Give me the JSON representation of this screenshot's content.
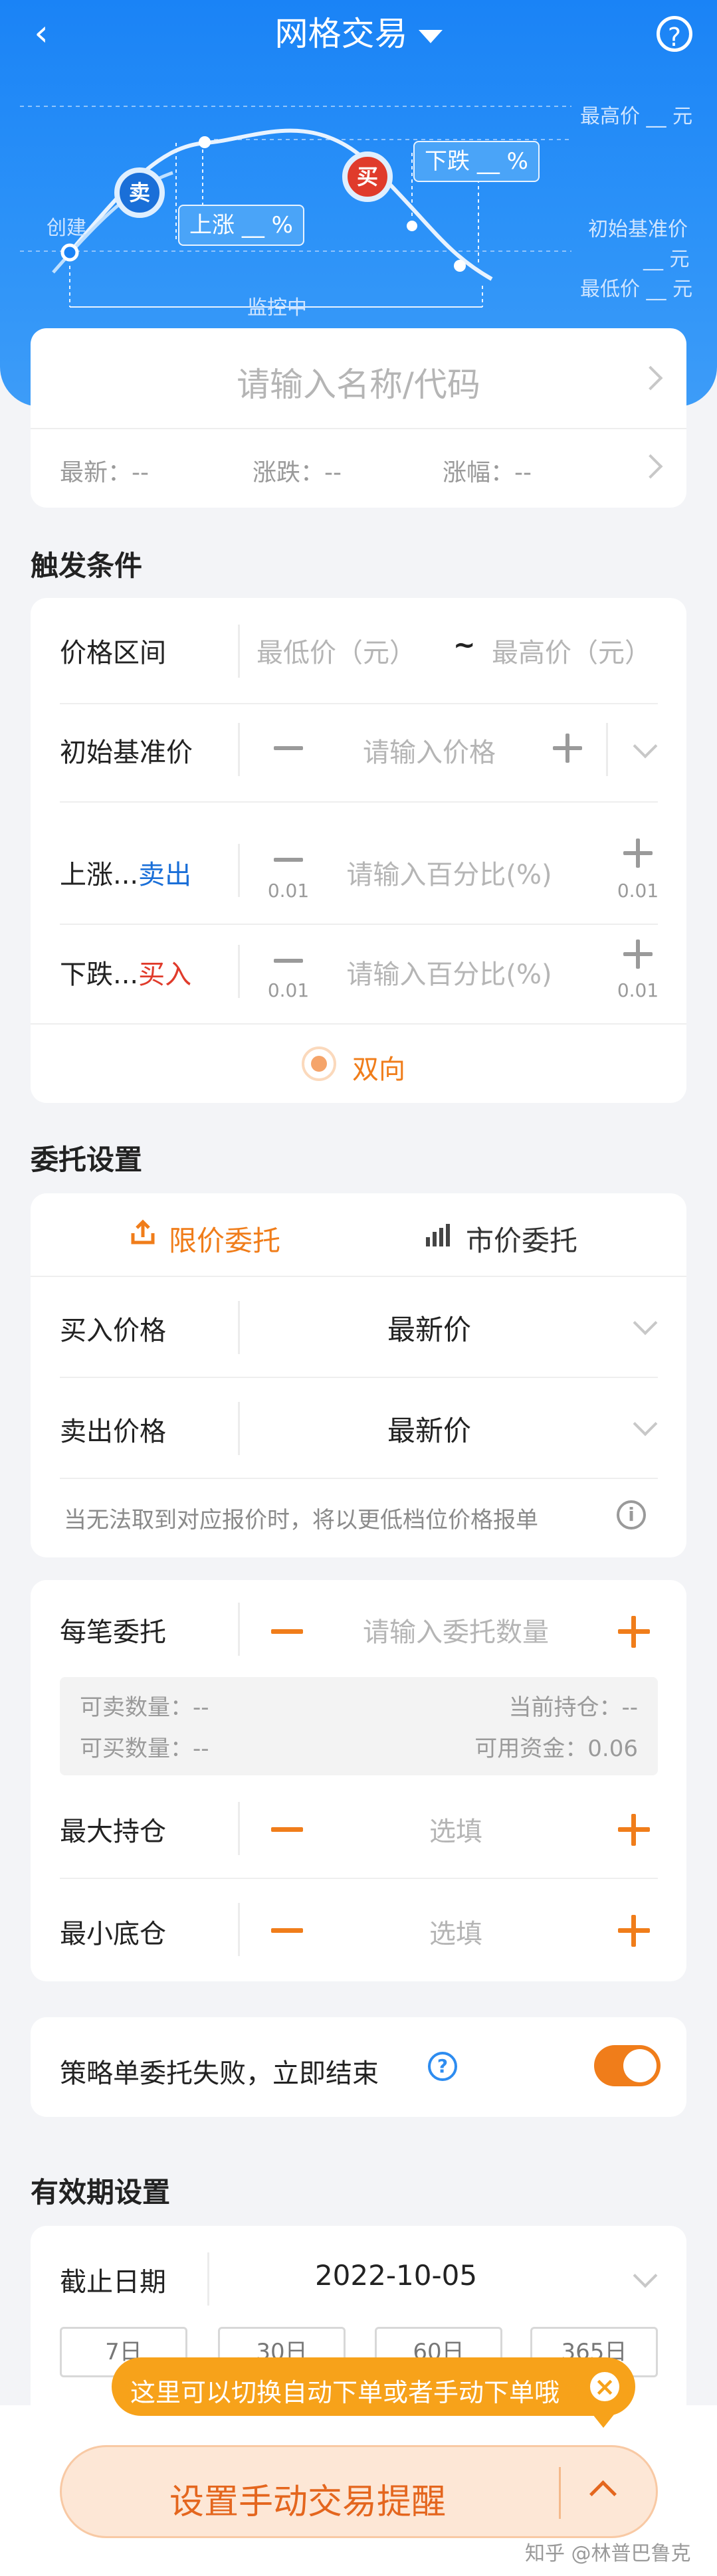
{
  "nav": {
    "back_icon": "‹",
    "title": "网格交易",
    "help_icon": "?"
  },
  "diagram": {
    "max_price": "最高价 __ 元",
    "base_price_line1": "初始基准价",
    "base_price_line2": "__ 元",
    "min_price": "最低价 __ 元",
    "create": "创建",
    "monitoring": "监控中",
    "sell_badge": "卖",
    "buy_badge": "买",
    "rise_tag": "上涨 __ %",
    "fall_tag": "下跌 __ %"
  },
  "stock": {
    "search_placeholder": "请输入名称/代码",
    "latest": "最新：--",
    "change": "涨跌：--",
    "change_pct": "涨幅：--"
  },
  "trigger": {
    "section_title": "触发条件",
    "price_range_label": "价格区间",
    "min_placeholder": "最低价（元）",
    "range_sep": "~",
    "max_placeholder": "最高价（元）",
    "base_label": "初始基准价",
    "base_placeholder": "请输入价格",
    "rise_label": "上涨...",
    "rise_action": "卖出",
    "rise_placeholder": "请输入百分比(%)",
    "step": "0.01",
    "fall_label": "下跌...",
    "fall_action": "买入",
    "fall_placeholder": "请输入百分比(%)",
    "bidirectional": "双向"
  },
  "order": {
    "section_title": "委托设置",
    "limit_tab": "限价委托",
    "market_tab": "市价委托",
    "buy_price_label": "买入价格",
    "buy_price_value": "最新价",
    "sell_price_label": "卖出价格",
    "sell_price_value": "最新价",
    "note": "当无法取到对应报价时，将以更低档位价格报单",
    "info_icon": "i"
  },
  "qty": {
    "per_order_label": "每笔委托",
    "per_order_placeholder": "请输入委托数量",
    "sellable": "可卖数量：--",
    "holding": "当前持仓：--",
    "buyable": "可买数量：--",
    "funds": "可用资金：0.06",
    "max_pos_label": "最大持仓",
    "max_pos_placeholder": "选填",
    "min_pos_label": "最小底仓",
    "min_pos_placeholder": "选填"
  },
  "fail": {
    "label": "策略单委托失败，立即结束",
    "help_icon": "?",
    "toggle_on": true
  },
  "validity": {
    "section_title": "有效期设置",
    "deadline_label": "截止日期",
    "deadline_value": "2022-10-05",
    "chips": [
      "7日",
      "30日",
      "60日",
      "365日"
    ]
  },
  "tooltip": {
    "text": "这里可以切换自动下单或者手动下单哦",
    "close_icon": "×"
  },
  "bottom": {
    "button_label": "设置手动交易提醒",
    "expand_icon": "^",
    "watermark": "知乎 @林普巴鲁克"
  },
  "colors": {
    "blue": "#1a83f6",
    "orange": "#f07d1a",
    "sell_blue": "#1a6fd8",
    "buy_red": "#e03b2b"
  }
}
